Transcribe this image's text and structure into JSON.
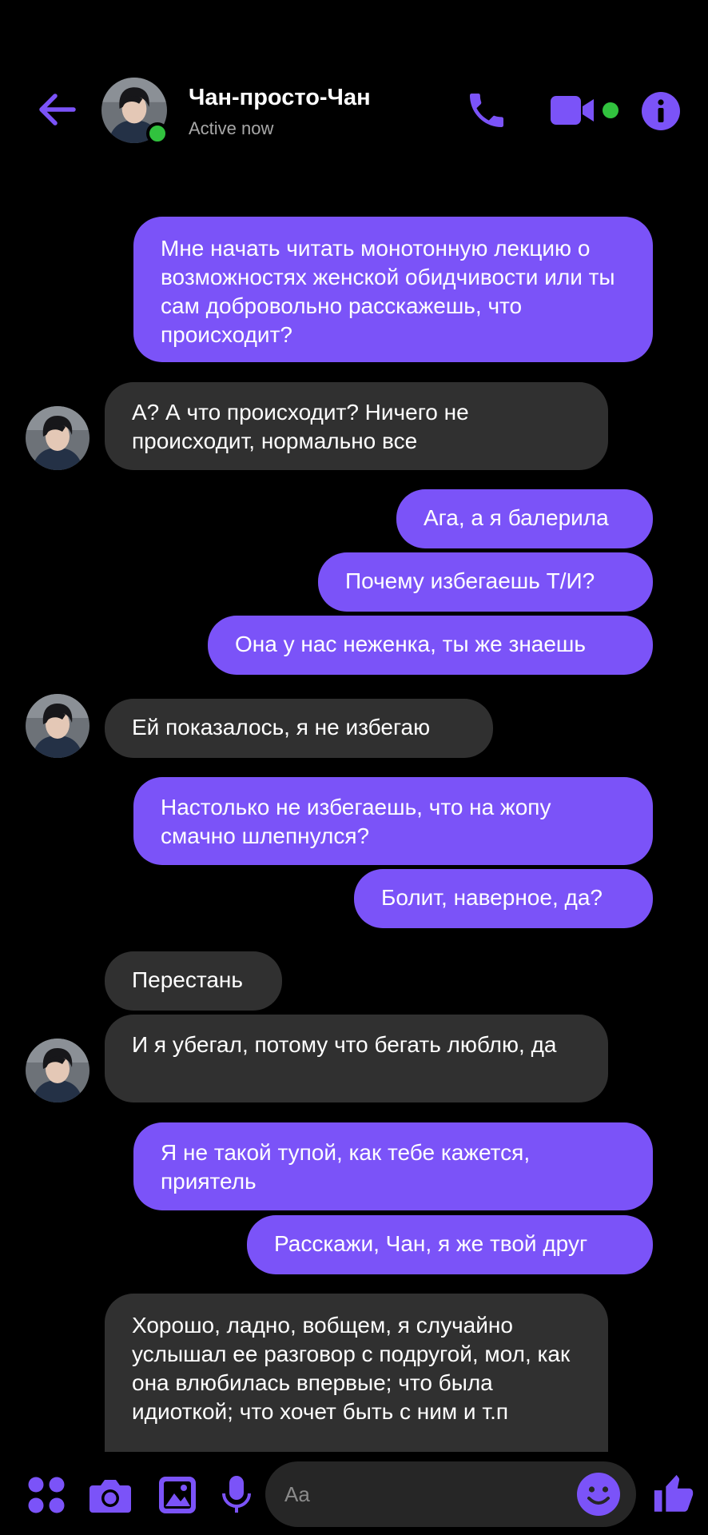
{
  "header": {
    "name": "Чан-просто-Чан",
    "status": "Active now"
  },
  "messages": [
    {
      "side": "out",
      "text": "Мне начать читать монотонную лекцию о возможностях женской обидчивости или ты сам добровольно расскажешь, что происходит?"
    },
    {
      "side": "in",
      "text": "А? А что происходит? Ничего не происходит, нормально все"
    },
    {
      "side": "out",
      "text": "Ага, а я балерила"
    },
    {
      "side": "out",
      "text": "Почему избегаешь Т/И?"
    },
    {
      "side": "out",
      "text": "Она у нас неженка, ты же знаешь"
    },
    {
      "side": "in",
      "text": "Ей показалось, я не избегаю"
    },
    {
      "side": "out",
      "text": "Настолько не избегаешь, что на жопу смачно шлепнулся?"
    },
    {
      "side": "out",
      "text": "Болит, наверное, да?"
    },
    {
      "side": "in",
      "text": "Перестань"
    },
    {
      "side": "in",
      "text": "И я убегал, потому что бегать люблю, да"
    },
    {
      "side": "out",
      "text": "Я не такой тупой, как тебе кажется, приятель"
    },
    {
      "side": "out",
      "text": "Расскажи, Чан, я же твой друг"
    },
    {
      "side": "in",
      "text": "Хорошо, ладно, вобщем, я случайно услышал ее разговор с подругой, мол, как она влюбилась впервые; что была идиоткой; что хочет быть с ним и т.п"
    }
  ],
  "composer": {
    "placeholder": "Aa"
  },
  "colors": {
    "accent": "#7b53f8",
    "incoming_bubble": "#303030",
    "online": "#31c23e",
    "background": "#000000"
  },
  "icons": [
    "back-arrow-icon",
    "phone-icon",
    "video-camera-icon",
    "info-icon",
    "apps-grid-icon",
    "camera-icon",
    "gallery-icon",
    "microphone-icon",
    "emoji-icon",
    "thumbs-up-icon"
  ]
}
